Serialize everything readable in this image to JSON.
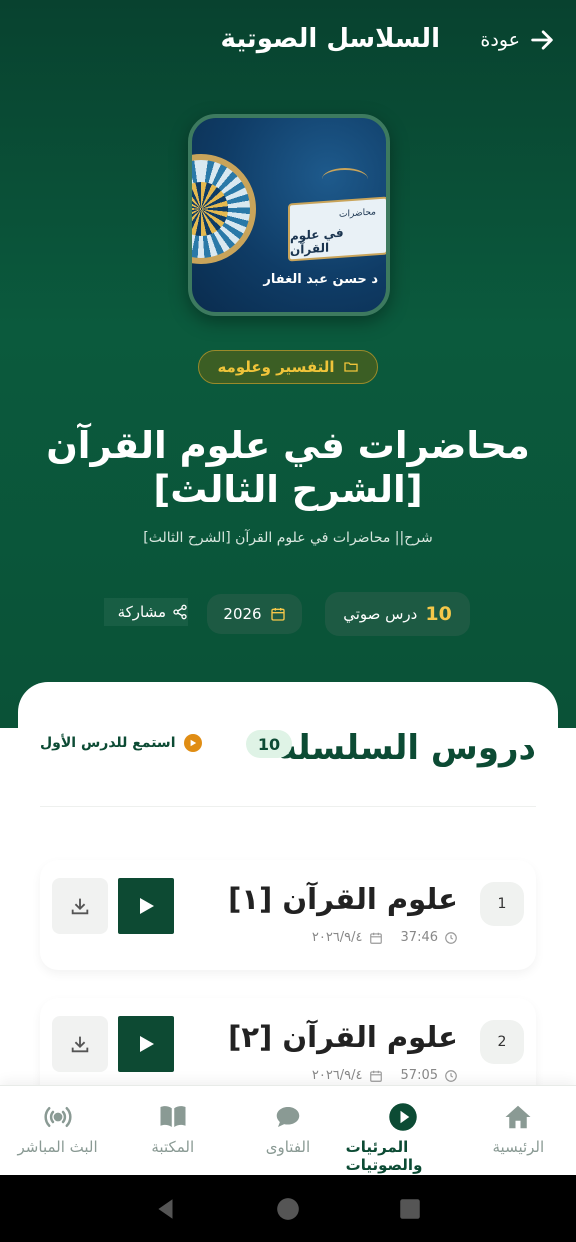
{
  "header": {
    "back_label": "عودة",
    "title": "السلاسل الصوتية"
  },
  "cover": {
    "line1": "محاضرات",
    "line2": "في علوم القرآن",
    "author": "د حسن عبد الغفار"
  },
  "series": {
    "category": "التفسير وعلومه",
    "title": "محاضرات في علوم القرآن [الشرح الثالث]",
    "subtitle": "شرح|| محاضرات في علوم القرآن [الشرح الثالث]",
    "lessons_count": "10",
    "lessons_label": "درس صوتي",
    "year": "2026",
    "share_label": "مشاركة"
  },
  "lessons_section": {
    "heading": "دروس السلسلة",
    "count": "10",
    "listen_first": "استمع للدرس الأول"
  },
  "lessons": [
    {
      "number": "1",
      "title": "علوم القرآن [١]",
      "duration": "37:46",
      "date": "٢٠٢٦/٩/٤"
    },
    {
      "number": "2",
      "title": "علوم القرآن [٢]",
      "duration": "57:05",
      "date": "٢٠٢٦/٩/٤"
    }
  ],
  "bottom_nav": [
    {
      "label": "الرئيسية",
      "icon": "home-icon"
    },
    {
      "label": "المرئيات والصوتيات",
      "icon": "play-circle-icon",
      "active": true
    },
    {
      "label": "الفتاوى",
      "icon": "chat-bubbles-icon"
    },
    {
      "label": "المكتبة",
      "icon": "book-icon"
    },
    {
      "label": "البث المباشر",
      "icon": "broadcast-icon"
    }
  ],
  "colors": {
    "primary": "#0c4b34",
    "accent": "#f5c84a",
    "orange": "#e08d14"
  }
}
